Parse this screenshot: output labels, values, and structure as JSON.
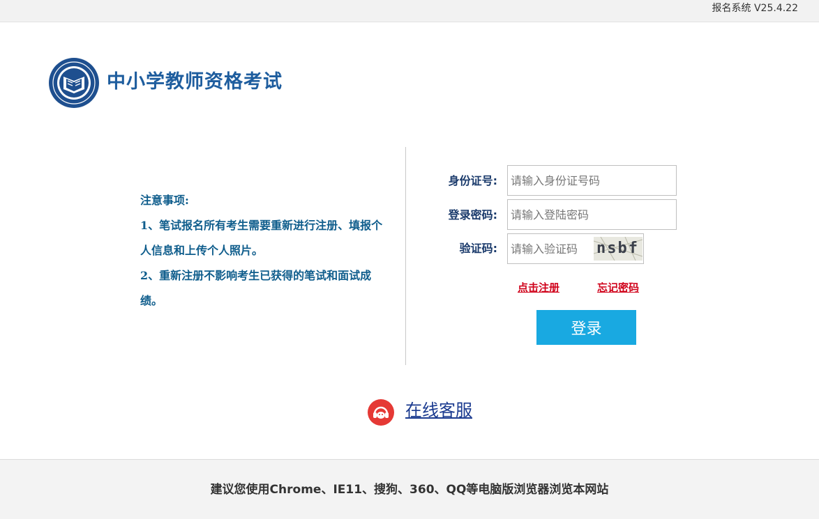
{
  "topbar": {
    "version_text": "报名系统 V25.4.22"
  },
  "header": {
    "site_title": "中小学教师资格考试",
    "logo_icon": "book-emblem-icon"
  },
  "notice": {
    "title": "注意事项:",
    "item1": "1、笔试报名所有考生需要重新进行注册、填报个人信息和上传个人照片。",
    "item2": "2、重新注册不影响考生已获得的笔试和面试成绩。"
  },
  "login_form": {
    "id_label": "身份证号:",
    "id_placeholder": "请输入身份证号码",
    "password_label": "登录密码:",
    "password_placeholder": "请输入登陆密码",
    "captcha_label": "验证码:",
    "captcha_placeholder": "请输入验证码",
    "captcha_text": "nsbf",
    "register_link": "点击注册",
    "forgot_link": "忘记密码",
    "login_button": "登录"
  },
  "support": {
    "icon": "customer-service-icon",
    "link_text": "在线客服"
  },
  "footer": {
    "text": "建议您使用Chrome、IE11、搜狗、360、QQ等电脑版浏览器浏览本网站"
  },
  "colors": {
    "brand_blue": "#1e5d9e",
    "button_blue": "#19a9e1",
    "link_red": "#d0021b",
    "notice_text": "#0f5d8c",
    "support_red": "#e53935"
  }
}
